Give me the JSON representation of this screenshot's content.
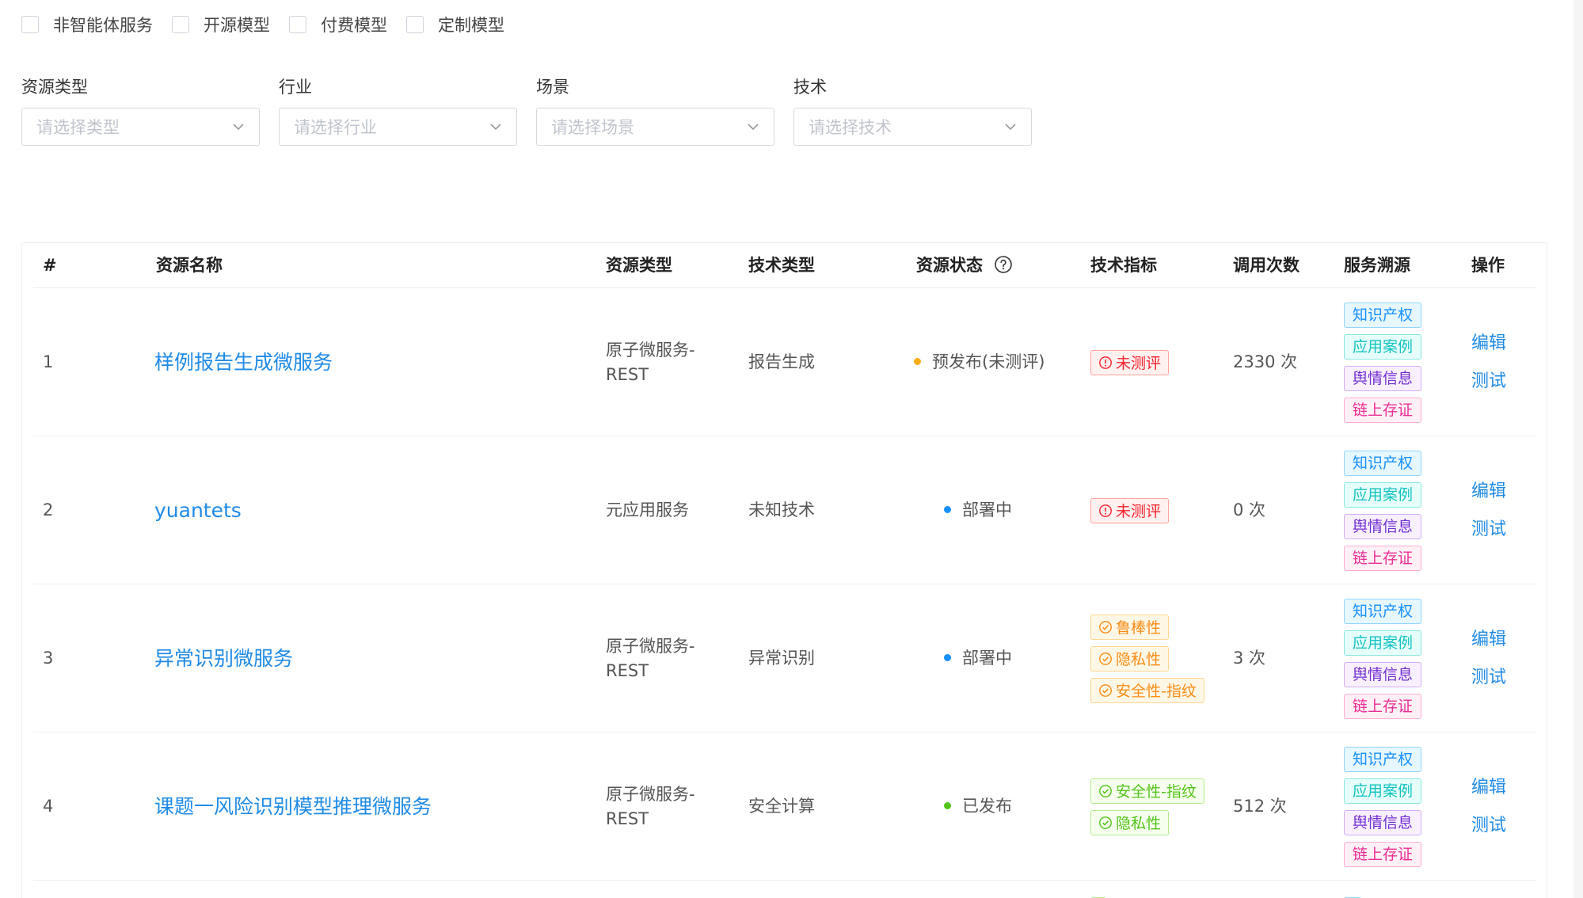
{
  "checkboxes": [
    {
      "label": "非智能体服务"
    },
    {
      "label": "开源模型"
    },
    {
      "label": "付费模型"
    },
    {
      "label": "定制模型"
    }
  ],
  "filters": [
    {
      "label": "资源类型",
      "placeholder": "请选择类型"
    },
    {
      "label": "行业",
      "placeholder": "请选择行业"
    },
    {
      "label": "场景",
      "placeholder": "请选择场景"
    },
    {
      "label": "技术",
      "placeholder": "请选择技术"
    }
  ],
  "table": {
    "headers": {
      "num": "#",
      "name": "资源名称",
      "type": "资源类型",
      "tech": "技术类型",
      "status": "资源状态",
      "metrics": "技术指标",
      "calls": "调用次数",
      "sources": "服务溯源",
      "ops": "操作"
    },
    "rows": [
      {
        "num": "1",
        "name": "样例报告生成微服务",
        "type": "原子微服务-REST",
        "tech": "报告生成",
        "status": "预发布(未测评)",
        "status_color": "#faad14",
        "metrics": [
          {
            "label": "未测评",
            "kind": "red"
          }
        ],
        "calls": "2330 次"
      },
      {
        "num": "2",
        "name": "yuantets",
        "type": "元应用服务",
        "tech": "未知技术",
        "status": "部署中",
        "status_color": "#1890ff",
        "metrics": [
          {
            "label": "未测评",
            "kind": "red"
          }
        ],
        "calls": "0 次"
      },
      {
        "num": "3",
        "name": "异常识别微服务",
        "type": "原子微服务-REST",
        "tech": "异常识别",
        "status": "部署中",
        "status_color": "#1890ff",
        "metrics": [
          {
            "label": "鲁棒性",
            "kind": "orange"
          },
          {
            "label": "隐私性",
            "kind": "orange"
          },
          {
            "label": "安全性-指纹",
            "kind": "orange"
          }
        ],
        "calls": "3 次"
      },
      {
        "num": "4",
        "name": "课题一风险识别模型推理微服务",
        "type": "原子微服务-REST",
        "tech": "安全计算",
        "status": "已发布",
        "status_color": "#52c41a",
        "metrics": [
          {
            "label": "安全性-指纹",
            "kind": "green"
          },
          {
            "label": "隐私性",
            "kind": "green"
          }
        ],
        "calls": "512 次"
      }
    ],
    "source_tags": [
      "知识产权",
      "应用案例",
      "舆情信息",
      "链上存证"
    ],
    "ops": {
      "edit": "编辑",
      "test": "测试"
    }
  }
}
